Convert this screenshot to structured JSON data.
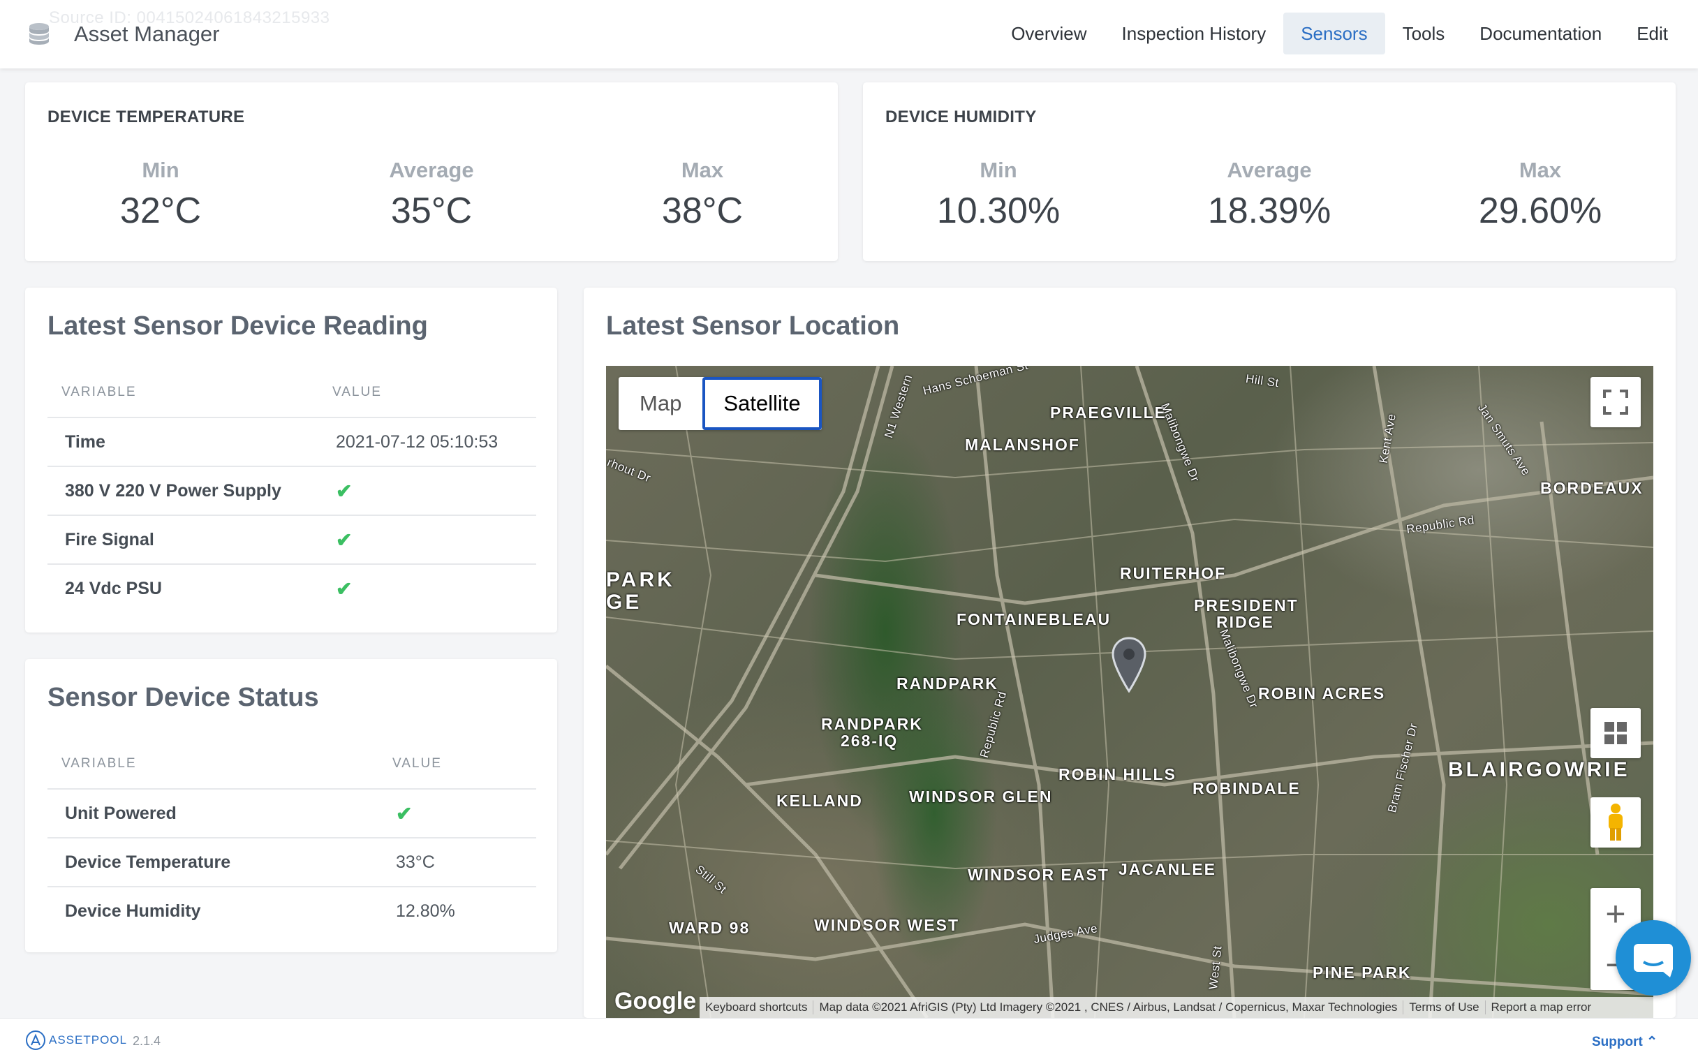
{
  "header": {
    "faint_text": "Source ID: 00415024061843215933",
    "app_title": "Asset Manager",
    "nav": [
      {
        "label": "Overview"
      },
      {
        "label": "Inspection History"
      },
      {
        "label": "Sensors",
        "active": true
      },
      {
        "label": "Tools"
      },
      {
        "label": "Documentation"
      },
      {
        "label": "Edit"
      }
    ]
  },
  "temperature": {
    "title": "DEVICE TEMPERATURE",
    "min_label": "Min",
    "min": "32°C",
    "avg_label": "Average",
    "avg": "35°C",
    "max_label": "Max",
    "max": "38°C"
  },
  "humidity": {
    "title": "DEVICE HUMIDITY",
    "min_label": "Min",
    "min": "10.30%",
    "avg_label": "Average",
    "avg": "18.39%",
    "max_label": "Max",
    "max": "29.60%"
  },
  "latest_reading": {
    "title": "Latest Sensor Device Reading",
    "col_variable": "VARIABLE",
    "col_value": "VALUE",
    "rows": [
      {
        "variable": "Time",
        "value": "2021-07-12 05:10:53"
      },
      {
        "variable": "380 V 220 V Power Supply",
        "value": "✔"
      },
      {
        "variable": "Fire Signal",
        "value": "✔"
      },
      {
        "variable": "24 Vdc PSU",
        "value": "✔"
      }
    ]
  },
  "device_status": {
    "title": "Sensor Device Status",
    "col_variable": "VARIABLE",
    "col_value": "VALUE",
    "rows": [
      {
        "variable": "Unit Powered",
        "value": "✔"
      },
      {
        "variable": "Device Temperature",
        "value": "33°C"
      },
      {
        "variable": "Device Humidity",
        "value": "12.80%"
      }
    ]
  },
  "location": {
    "title": "Latest Sensor Location",
    "map_type_map": "Map",
    "map_type_satellite": "Satellite",
    "selected_map_type": "Satellite",
    "labels": {
      "praegville": "PRAEGVILLE",
      "malanshof": "MALANSHOF",
      "bordeaux": "BORDEAUX",
      "ruiterhof": "RUITERHOF",
      "president_ridge_1": "PRESIDENT",
      "president_ridge_2": "RIDGE",
      "fontainebleau": "FONTAINEBLEAU",
      "randpark": "RANDPARK",
      "robin_acres": "ROBIN ACRES",
      "randpark_268_1": "RANDPARK",
      "randpark_268_2": "268-IQ",
      "blairgowrie": "BLAIRGOWRIE",
      "robin_hills": "ROBIN HILLS",
      "robindale": "ROBINDALE",
      "kelland": "KELLAND",
      "windsor_glen": "WINDSOR GLEN",
      "windsor_east": "WINDSOR EAST",
      "jacanlee": "JACANLEE",
      "ward_98": "WARD 98",
      "windsor_west": "WINDSOR WEST",
      "pine_park": "PINE PARK",
      "park_1": "PARK",
      "park_2": "GE",
      "hans_schoeman": "Hans Schoeman St",
      "hill_st": "Hill St",
      "n1_western": "N1 Western",
      "malibongwe_1": "Malibongwe Dr",
      "kent_ave": "Kent Ave",
      "jan_smuts": "Jan Smuts Ave",
      "republic_rd": "Republic Rd",
      "malibongwe_2": "Malibongwe Dr",
      "republic_rd_2": "Republic Rd",
      "bram_fischer": "Bram Fischer Dr",
      "judges_ave": "Judges Ave",
      "still_st": "Still St",
      "west_st": "West St",
      "rahout": "rhout Dr"
    },
    "google": "Google",
    "attribution": {
      "shortcuts": "Keyboard shortcuts",
      "data": "Map data ©2021 AfriGIS (Pty) Ltd Imagery ©2021 , CNES / Airbus, Landsat / Copernicus, Maxar Technologies",
      "terms": "Terms of Use",
      "report": "Report a map error"
    }
  },
  "footer": {
    "brand": "ASSETPOOL",
    "version": "2.1.4",
    "support": "Support"
  },
  "colors": {
    "accent": "#2a6ec4",
    "check": "#3bbf62",
    "chat": "#1f8fd6"
  }
}
